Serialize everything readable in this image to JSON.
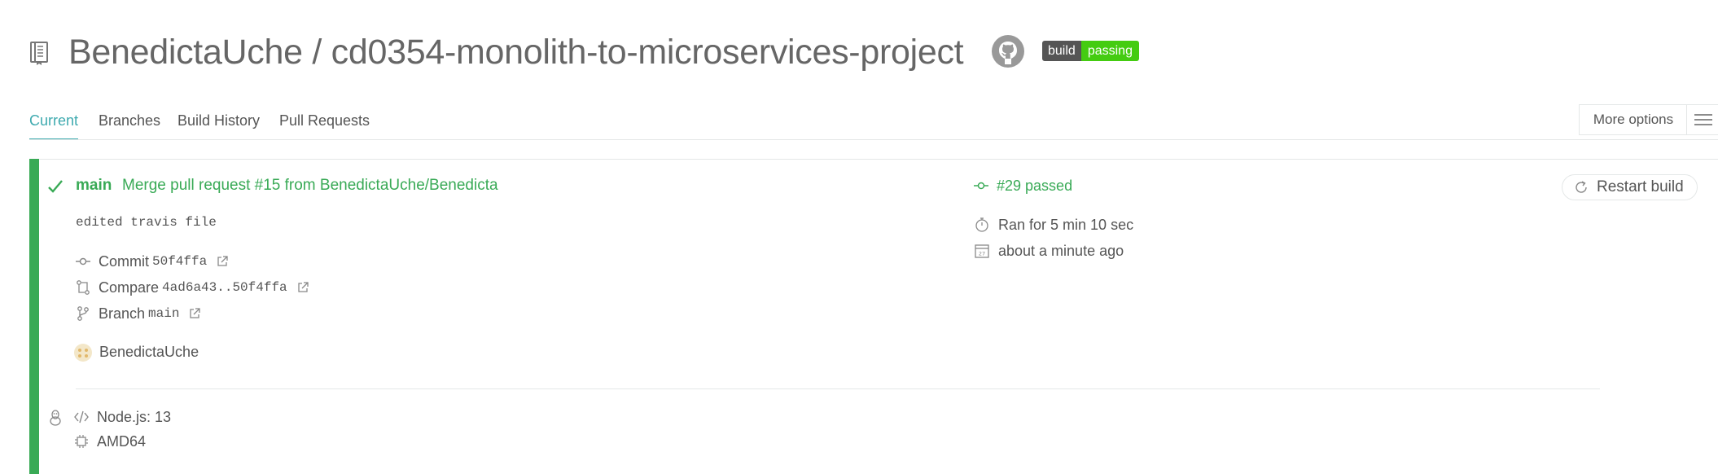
{
  "header": {
    "repo_title": "BenedictaUche / cd0354-monolith-to-microservices-project",
    "badge_left": "build",
    "badge_right": "passing",
    "icons": [
      "repo-icon",
      "github-icon"
    ]
  },
  "tabs": [
    {
      "label": "Current",
      "active": true
    },
    {
      "label": "Branches",
      "active": false
    },
    {
      "label": "Build History",
      "active": false
    },
    {
      "label": "Pull Requests",
      "active": false
    }
  ],
  "more_options": "More options",
  "build": {
    "status": "passed",
    "status_color": "#39aa56",
    "branch": "main",
    "message_title": "Merge pull request #15 from BenedictaUche/Benedicta",
    "message_body": "edited travis file",
    "commit_label": "Commit",
    "commit_sha": "50f4ffa",
    "compare_label": "Compare",
    "compare_range": "4ad6a43..50f4ffa",
    "branch_label": "Branch",
    "branch_value": "main",
    "author": "BenedictaUche",
    "number_text": "#29 passed",
    "duration": "Ran for 5 min 10 sec",
    "finished": "about a minute ago",
    "restart_label": "Restart build",
    "language": "Node.js: 13",
    "arch": "AMD64"
  },
  "colors": {
    "accent_teal": "#3eaaaf",
    "passed_green": "#39aa56",
    "badge_green": "#44cc11"
  }
}
